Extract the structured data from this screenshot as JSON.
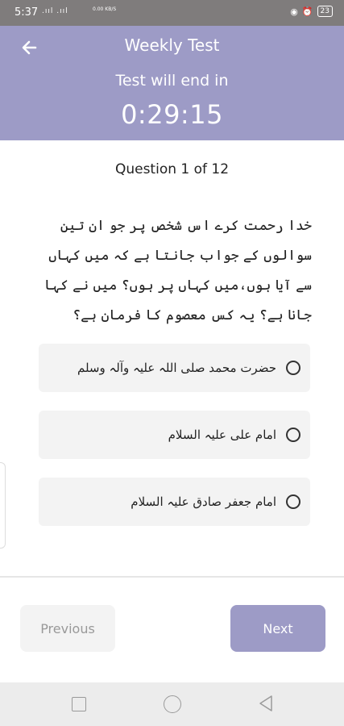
{
  "status_bar": {
    "time": "5:37",
    "signal": ".ııl .ııl",
    "speed": "0.00 KB/S",
    "battery": "23"
  },
  "header": {
    "title": "Weekly Test",
    "subtitle": "Test will end in",
    "timer": "0:29:15"
  },
  "question": {
    "counter": "Question 1 of 12",
    "text": "خدا رحمت کرے اس شخص پر جو ان تین سوالوں کے جواب جانتا ہے کہ میں کہاں سے آیا ہوں،میں کہاں پر ہوں؟ میں نے کہا جانا ہے؟ یہ کس معصوم کا فرمان ہے؟"
  },
  "options": [
    {
      "label": "حضرت محمد صلی اللہ علیہ وآلہ وسلم",
      "selected": false
    },
    {
      "label": "امام علی علیہ السلام",
      "selected": false
    },
    {
      "label": "امام جعفر صادق علیہ السلام",
      "selected": false
    }
  ],
  "buttons": {
    "previous": "Previous",
    "next": "Next"
  },
  "colors": {
    "accent": "#9d9bc6",
    "option_bg": "#f3f3f3",
    "status_bar": "#7f7c7c"
  },
  "icons": {
    "back": "arrow-left-icon",
    "radio": "radio-unchecked-icon",
    "nav_recent": "square-icon",
    "nav_home": "circle-icon",
    "nav_back": "triangle-back-icon"
  }
}
